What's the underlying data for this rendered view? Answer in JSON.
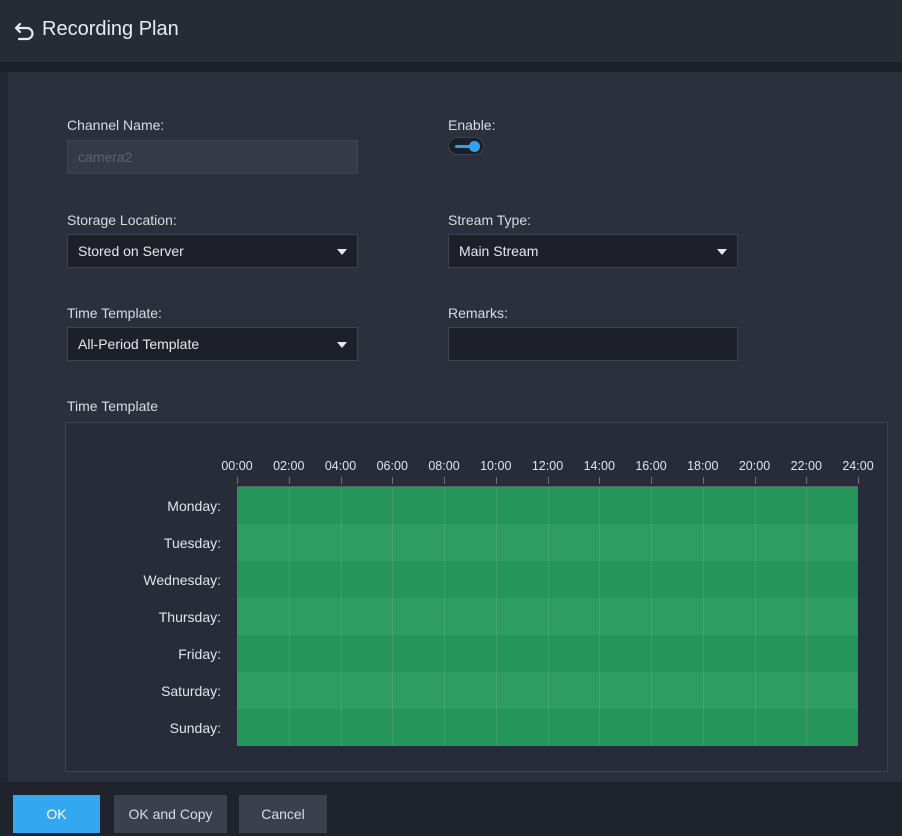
{
  "header": {
    "title": "Recording Plan"
  },
  "form": {
    "channel_name_label": "Channel Name:",
    "channel_name_value": "camera2",
    "enable_label": "Enable:",
    "enable_on": true,
    "storage_location_label": "Storage Location:",
    "storage_location_value": "Stored on Server",
    "stream_type_label": "Stream Type:",
    "stream_type_value": "Main Stream",
    "time_template_label": "Time Template:",
    "time_template_value": "All-Period Template",
    "remarks_label": "Remarks:",
    "remarks_value": ""
  },
  "schedule": {
    "section_title": "Time Template",
    "hours": [
      "00:00",
      "02:00",
      "04:00",
      "06:00",
      "08:00",
      "10:00",
      "12:00",
      "14:00",
      "16:00",
      "18:00",
      "20:00",
      "22:00",
      "24:00"
    ],
    "days": [
      "Monday:",
      "Tuesday:",
      "Wednesday:",
      "Thursday:",
      "Friday:",
      "Saturday:",
      "Sunday:"
    ],
    "active_color": "#279a5c"
  },
  "footer": {
    "ok_label": "OK",
    "ok_copy_label": "OK and Copy",
    "cancel_label": "Cancel"
  },
  "colors": {
    "accent": "#33a7f0",
    "background": "#2b303c"
  }
}
